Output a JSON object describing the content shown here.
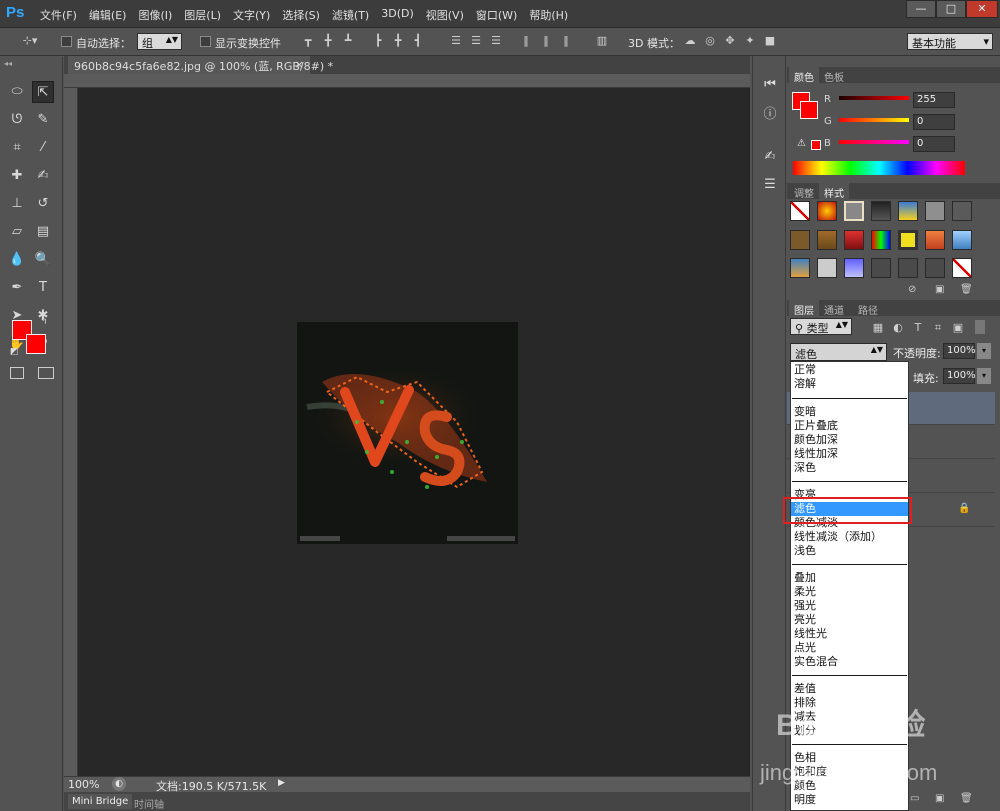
{
  "app": {
    "logo": "Ps",
    "menu": [
      "文件(F)",
      "编辑(E)",
      "图像(I)",
      "图层(L)",
      "文字(Y)",
      "选择(S)",
      "滤镜(T)",
      "3D(D)",
      "视图(V)",
      "窗口(W)",
      "帮助(H)"
    ],
    "window_controls": [
      "—",
      "□",
      "✕"
    ]
  },
  "options": {
    "auto_select_label": "自动选择：",
    "auto_select_value": "组",
    "show_transform_label": "显示变换控件",
    "mode_3d_label": "3D 模式：",
    "workspace": "基本功能"
  },
  "document": {
    "tab_title": "960b8c94c5fa6e82.jpg @ 100% (蓝, RGB/8#) *",
    "tab_close": "×",
    "zoom": "100%",
    "doc_size": "文档:190.5 K/571.5K",
    "artwork_text": "VS"
  },
  "bottom_tabs": [
    "Mini Bridge",
    "时间轴"
  ],
  "color_panel": {
    "tabs": [
      "颜色",
      "色板"
    ],
    "channels": [
      {
        "label": "R",
        "value": "255"
      },
      {
        "label": "G",
        "value": "0"
      },
      {
        "label": "B",
        "value": "0"
      }
    ],
    "foreground": "#ff0000"
  },
  "styles_panel": {
    "tabs": [
      "调整",
      "样式"
    ]
  },
  "layers_panel": {
    "tabs": [
      "图层",
      "通道",
      "路径"
    ],
    "filter_kind": "类型",
    "blend_mode": "滤色",
    "opacity_label": "不透明度:",
    "opacity_value": "100%",
    "fill_label": "填充:",
    "fill_value": "100%",
    "lock_icon": "🔒"
  },
  "blend_menu": {
    "groups": [
      [
        "正常",
        "溶解"
      ],
      [
        "变暗",
        "正片叠底",
        "颜色加深",
        "线性加深",
        "深色"
      ],
      [
        "变亮",
        "滤色",
        "颜色减淡",
        "线性减淡（添加）",
        "浅色"
      ],
      [
        "叠加",
        "柔光",
        "强光",
        "亮光",
        "线性光",
        "点光",
        "实色混合"
      ],
      [
        "差值",
        "排除",
        "减去",
        "划分"
      ],
      [
        "色相",
        "饱和度",
        "颜色",
        "明度"
      ]
    ],
    "selected": "滤色"
  },
  "watermark": {
    "brand": "Baidu经验",
    "url": "jingyan.baidu.com"
  }
}
